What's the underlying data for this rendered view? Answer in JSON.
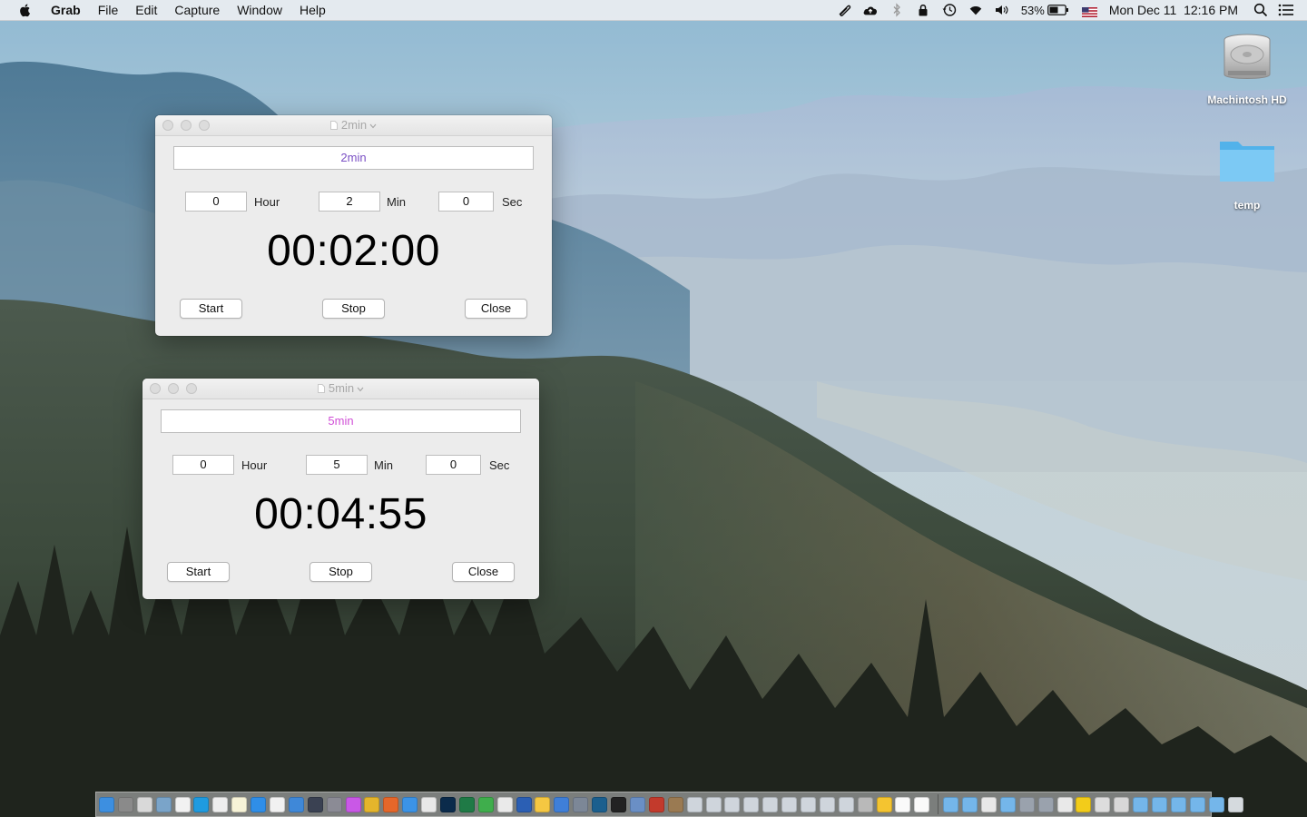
{
  "menubar": {
    "app_name": "Grab",
    "menus": [
      "File",
      "Edit",
      "Capture",
      "Window",
      "Help"
    ],
    "battery_percent": "53%",
    "datetime": "Mon Dec 11  12:16 PM",
    "status_icons": [
      "paperclip-icon",
      "cloud-upload-icon",
      "bluetooth-icon",
      "lock-icon",
      "time-machine-icon",
      "wifi-icon",
      "volume-icon",
      "battery-icon",
      "us-flag-icon",
      "spotlight-icon",
      "notification-center-icon"
    ]
  },
  "desktop": {
    "icons": [
      {
        "label": "Machintosh HD",
        "icon": "hard-drive-icon"
      },
      {
        "label": "temp",
        "icon": "folder-icon"
      }
    ]
  },
  "windows": [
    {
      "title": "2min",
      "name_value": "2min",
      "name_color": "#7a4fc4",
      "hour": "0",
      "hour_label": "Hour",
      "min": "2",
      "min_label": "Min",
      "sec": "0",
      "sec_label": "Sec",
      "display": "00:02:00",
      "start_label": "Start",
      "stop_label": "Stop",
      "close_label": "Close"
    },
    {
      "title": "5min",
      "name_value": "5min",
      "name_color": "#d04fd6",
      "hour": "0",
      "hour_label": "Hour",
      "min": "5",
      "min_label": "Min",
      "sec": "0",
      "sec_label": "Sec",
      "display": "00:04:55",
      "start_label": "Start",
      "stop_label": "Stop",
      "close_label": "Close"
    }
  ],
  "dock": {
    "apps": [
      {
        "name": "finder",
        "color": "#3d8fe0"
      },
      {
        "name": "launchpad",
        "color": "#8a8a8a"
      },
      {
        "name": "photos",
        "color": "#d9d9d9"
      },
      {
        "name": "preview",
        "color": "#7aa4c9"
      },
      {
        "name": "calendar",
        "color": "#f2f2f2"
      },
      {
        "name": "skype",
        "color": "#1f9be0"
      },
      {
        "name": "textedit",
        "color": "#eeeeee"
      },
      {
        "name": "notes",
        "color": "#f7f3d7"
      },
      {
        "name": "app-store",
        "color": "#2f8ee8"
      },
      {
        "name": "pages",
        "color": "#f1f1f1"
      },
      {
        "name": "xcode",
        "color": "#3f88d8"
      },
      {
        "name": "terminal-dev",
        "color": "#3a4152"
      },
      {
        "name": "system-preferences",
        "color": "#8b8b95"
      },
      {
        "name": "itunes",
        "color": "#c958e6"
      },
      {
        "name": "chrome",
        "color": "#e4b52c"
      },
      {
        "name": "firefox",
        "color": "#e6672a"
      },
      {
        "name": "safari",
        "color": "#3b93e6"
      },
      {
        "name": "pdf-reader",
        "color": "#e8e8e8"
      },
      {
        "name": "photoshop",
        "color": "#0b2b4b"
      },
      {
        "name": "excel",
        "color": "#1f7a46"
      },
      {
        "name": "numbers",
        "color": "#3fae4c"
      },
      {
        "name": "script-editor",
        "color": "#eaeaea"
      },
      {
        "name": "word",
        "color": "#2b5fb4"
      },
      {
        "name": "sketch",
        "color": "#f5c742"
      },
      {
        "name": "keynote",
        "color": "#3f7fd8"
      },
      {
        "name": "grab",
        "color": "#7c8797"
      },
      {
        "name": "quicktime",
        "color": "#1b5f8e"
      },
      {
        "name": "terminal",
        "color": "#222222"
      },
      {
        "name": "activity-monitor",
        "color": "#6a8fc5"
      },
      {
        "name": "acrobat",
        "color": "#c33a2c"
      },
      {
        "name": "gimp",
        "color": "#9a7a52"
      },
      {
        "name": "downloads-1",
        "color": "#cfd5dc"
      },
      {
        "name": "downloads-2",
        "color": "#cfd5dc"
      },
      {
        "name": "downloads-3",
        "color": "#cfd5dc"
      },
      {
        "name": "downloads-4",
        "color": "#cfd5dc"
      },
      {
        "name": "downloads-5",
        "color": "#cfd5dc"
      },
      {
        "name": "downloads-6",
        "color": "#cfd5dc"
      },
      {
        "name": "downloads-7",
        "color": "#cfd5dc"
      },
      {
        "name": "downloads-8",
        "color": "#cfd5dc"
      },
      {
        "name": "downloads-9",
        "color": "#cfd5dc"
      },
      {
        "name": "archive",
        "color": "#b9b9b9"
      },
      {
        "name": "google-drive",
        "color": "#f4c430"
      },
      {
        "name": "clock-1",
        "color": "#fafafa"
      },
      {
        "name": "clock-2",
        "color": "#fafafa"
      }
    ],
    "stacks": [
      {
        "name": "applications-folder",
        "color": "#74b6ea"
      },
      {
        "name": "mail-folder",
        "color": "#74b6ea"
      },
      {
        "name": "documents-folder",
        "color": "#e8e8e8"
      },
      {
        "name": "folder-a",
        "color": "#74b6ea"
      },
      {
        "name": "folder-b",
        "color": "#9aa2ad"
      },
      {
        "name": "folder-c",
        "color": "#9aa2ad"
      },
      {
        "name": "home-folder",
        "color": "#e9e9e9"
      },
      {
        "name": "norton",
        "color": "#f2cc1a"
      },
      {
        "name": "stack-docs",
        "color": "#dddddd"
      },
      {
        "name": "x-app",
        "color": "#d8d8d8"
      },
      {
        "name": "folder-d",
        "color": "#74b6ea"
      },
      {
        "name": "folder-e",
        "color": "#74b6ea"
      },
      {
        "name": "folder-f",
        "color": "#74b6ea"
      },
      {
        "name": "folder-g",
        "color": "#74b6ea"
      },
      {
        "name": "folder-h",
        "color": "#74b6ea"
      },
      {
        "name": "trash",
        "color": "#d5dade"
      }
    ]
  }
}
